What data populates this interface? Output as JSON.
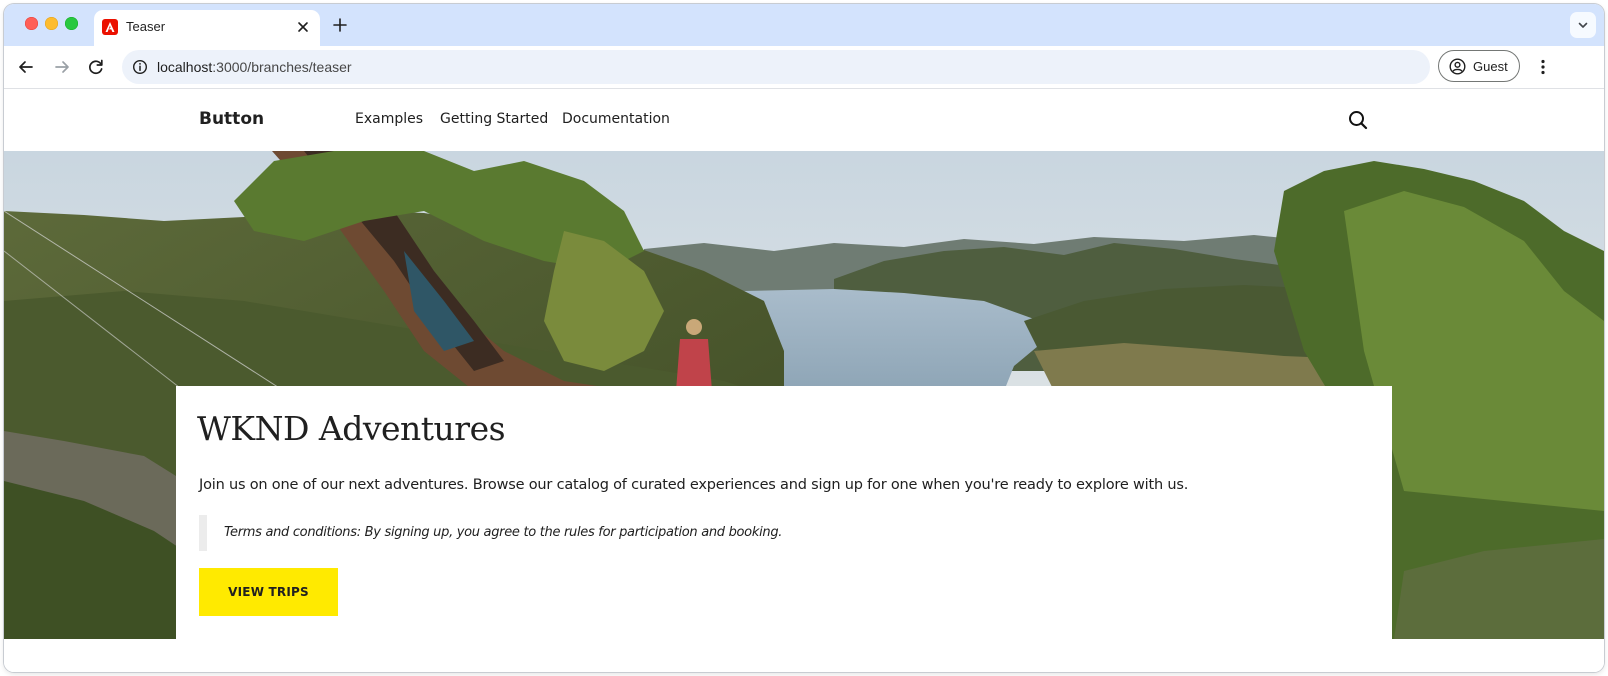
{
  "browser": {
    "tab_title": "Teaser",
    "url_host": "localhost",
    "url_path": ":3000/branches/teaser",
    "profile_label": "Guest"
  },
  "site": {
    "brand": "Button",
    "nav": [
      "Examples",
      "Getting Started",
      "Documentation"
    ]
  },
  "teaser": {
    "title": "WKND Adventures",
    "description": "Join us on one of our next adventures. Browse our catalog of curated experiences and sign up for one when you're ready to explore with us.",
    "terms": "Terms and conditions: By signing up, you agree to the rules for participation and booking.",
    "cta_label": "VIEW TRIPS"
  },
  "icons": {
    "favicon": "adobe-logo-icon",
    "search": "search-icon",
    "profile": "account-circle-icon"
  },
  "colors": {
    "cta_background": "#ffea00",
    "tabstrip": "#d3e3fd",
    "omnibox": "#edf2fa"
  }
}
